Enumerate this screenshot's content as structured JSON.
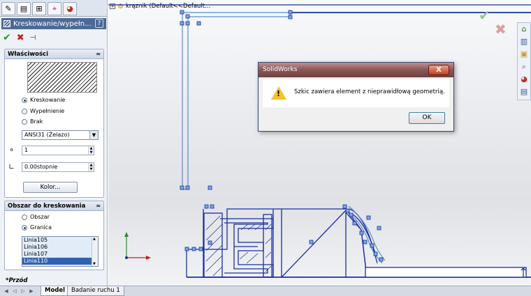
{
  "tree_flyout": {
    "expander": "+",
    "text": "krąznik  (Default<<Default..."
  },
  "panel_tabs": [
    {
      "name": "feature-manager",
      "glyph": "✎"
    },
    {
      "name": "property-manager",
      "glyph": "▤"
    },
    {
      "name": "configuration-manager",
      "glyph": "⊞"
    },
    {
      "name": "dimxpert",
      "glyph": "⌖"
    },
    {
      "name": "display-manager",
      "glyph": "◕"
    }
  ],
  "property_manager": {
    "title": "Kreskowanie/wypełn...",
    "help": "?",
    "ok_glyph": "✔",
    "cancel_glyph": "✖",
    "pin_glyph": "⊣"
  },
  "properties_group": {
    "title": "Właściwości",
    "collapse": "≈",
    "fill_options": [
      {
        "label": "Kreskowanie",
        "selected": true
      },
      {
        "label": "Wypełnienie",
        "selected": false
      },
      {
        "label": "Brak",
        "selected": false
      }
    ],
    "pattern": "ANSI31 (Żelazo)",
    "scale": "1",
    "angle": "0.00stopnie",
    "color_button": "Kolor..."
  },
  "area_group": {
    "title": "Obszar do kreskowania",
    "collapse": "≈",
    "options": [
      {
        "label": "Obszar",
        "selected": false
      },
      {
        "label": "Granica",
        "selected": true
      }
    ],
    "list": [
      {
        "label": "Linia105",
        "selected": false
      },
      {
        "label": "Linia106",
        "selected": false
      },
      {
        "label": "Linia107",
        "selected": false
      },
      {
        "label": "Linia110",
        "selected": true
      }
    ]
  },
  "dialog": {
    "title": "SolidWorks",
    "close": "X",
    "message": "Szkic zawiera element z nieprawidłową geometrią.",
    "ok": "OK"
  },
  "view_label": "*Przód",
  "bottom_tabs": [
    {
      "label": "Model",
      "active": true
    },
    {
      "label": "Badanie ruchu 1",
      "active": false
    }
  ],
  "colors": {
    "sketch": "#1a2f9c",
    "selected_sketch": "#5b8bd0",
    "dialog_title": "#8a5656",
    "panel_title": "#4d6a96"
  }
}
